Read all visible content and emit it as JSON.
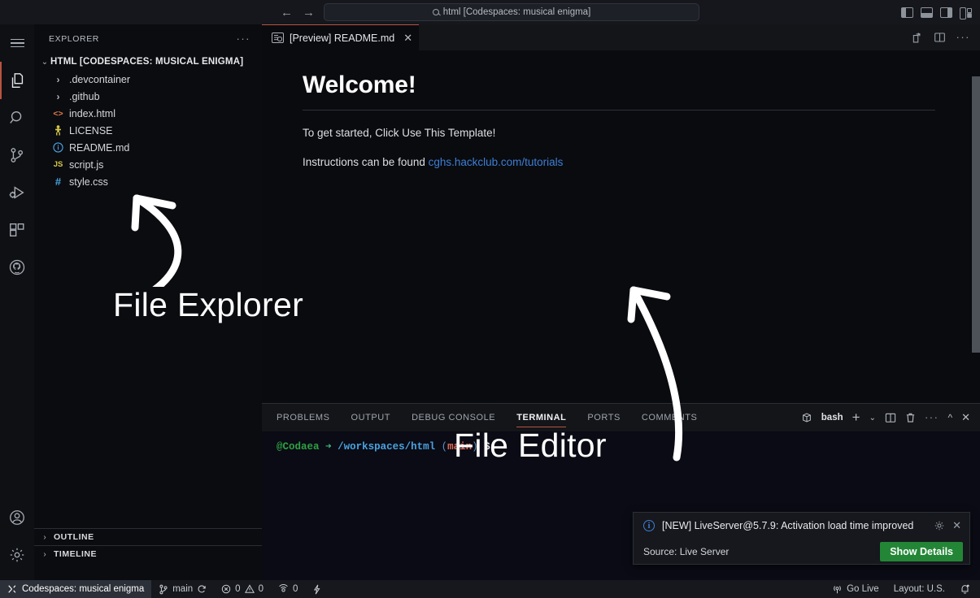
{
  "titlebar": {
    "back_icon": "arrow-left-icon",
    "forward_icon": "arrow-right-icon",
    "search_value": "html [Codespaces: musical enigma]",
    "search_placeholder": "Search",
    "layout_icons": [
      "toggle-primary-sidebar-icon",
      "toggle-panel-icon",
      "toggle-secondary-sidebar-icon",
      "customize-layout-icon"
    ]
  },
  "activitybar": {
    "items": [
      {
        "name": "menu-icon",
        "label": "Menu"
      },
      {
        "name": "explorer-icon",
        "label": "Explorer",
        "active": true
      },
      {
        "name": "search-icon",
        "label": "Search"
      },
      {
        "name": "source-control-icon",
        "label": "Source Control"
      },
      {
        "name": "run-and-debug-icon",
        "label": "Run and Debug"
      },
      {
        "name": "extensions-icon",
        "label": "Extensions"
      },
      {
        "name": "github-icon",
        "label": "GitHub"
      }
    ],
    "bottom_items": [
      {
        "name": "account-icon",
        "label": "Accounts"
      },
      {
        "name": "manage-gear-icon",
        "label": "Manage"
      }
    ]
  },
  "sidebar": {
    "title": "EXPLORER",
    "more_actions": "···",
    "root": {
      "label": "HTML [CODESPACES: MUSICAL ENIGMA]",
      "expanded": true
    },
    "files": [
      {
        "name": ".devcontainer",
        "type": "folder",
        "icon": "chevron-right-icon",
        "icon_char": "›",
        "color": "#b2b7bd"
      },
      {
        "name": ".github",
        "type": "folder",
        "icon": "chevron-right-icon",
        "icon_char": "›",
        "color": "#b2b7bd"
      },
      {
        "name": "index.html",
        "type": "file",
        "icon": "html-file-icon",
        "icon_char": "<>",
        "color": "#e07b4c"
      },
      {
        "name": "LICENSE",
        "type": "file",
        "icon": "license-file-icon",
        "icon_char": "⚕",
        "color": "#d7c84a"
      },
      {
        "name": "README.md",
        "type": "file",
        "icon": "markdown-info-icon",
        "icon_char": "ⓘ",
        "color": "#4aa3e0"
      },
      {
        "name": "script.js",
        "type": "file",
        "icon": "javascript-file-icon",
        "icon_char": "JS",
        "color": "#d7c84a"
      },
      {
        "name": "style.css",
        "type": "file",
        "icon": "css-file-icon",
        "icon_char": "#",
        "color": "#4aa3e0"
      }
    ],
    "sections": [
      {
        "label": "OUTLINE",
        "icon": "chevron-right-icon"
      },
      {
        "label": "TIMELINE",
        "icon": "chevron-right-icon"
      }
    ]
  },
  "editor": {
    "tab": {
      "label": "[Preview] README.md",
      "icon": "preview-icon",
      "close": "✕"
    },
    "actions": [
      {
        "name": "open-preview-to-side-icon"
      },
      {
        "name": "split-editor-icon"
      },
      {
        "name": "more-actions-icon",
        "char": "···"
      }
    ],
    "preview": {
      "heading": "Welcome!",
      "paragraph1": "To get started, Click Use This Template!",
      "paragraph2_prefix": "Instructions can be found ",
      "paragraph2_link": "cghs.hackclub.com/tutorials"
    }
  },
  "panel": {
    "tabs": [
      {
        "label": "PROBLEMS",
        "active": false
      },
      {
        "label": "OUTPUT",
        "active": false
      },
      {
        "label": "DEBUG CONSOLE",
        "active": false
      },
      {
        "label": "TERMINAL",
        "active": true
      },
      {
        "label": "PORTS",
        "active": false
      },
      {
        "label": "COMMENTS",
        "active": false
      }
    ],
    "shell_label": "bash",
    "actions": [
      {
        "name": "new-terminal-icon",
        "char": "+"
      },
      {
        "name": "chevron-down-icon",
        "char": "∨"
      },
      {
        "name": "split-terminal-icon"
      },
      {
        "name": "kill-terminal-icon"
      },
      {
        "name": "terminal-more-actions-icon",
        "char": "···"
      },
      {
        "name": "maximize-panel-icon",
        "char": "∧"
      },
      {
        "name": "close-panel-icon",
        "char": "✕"
      }
    ],
    "terminal_prompt": {
      "user": "@Codaea",
      "arrow": "➜",
      "path": "/workspaces/html",
      "paren_open": "(",
      "branch": "main",
      "paren_close": ")",
      "dollar": "$"
    }
  },
  "notification": {
    "icon": "info-icon",
    "message": "[NEW] LiveServer@5.7.9: Activation load time improved",
    "gear_icon": "gear-icon",
    "close_icon": "✕",
    "source": "Source: Live Server",
    "button": "Show Details",
    "button_color": "#238636"
  },
  "statusbar": {
    "remote": {
      "icon": "remote-indicator-icon",
      "label": "Codespaces: musical enigma"
    },
    "branch": {
      "icon": "source-control-icon",
      "label": "main",
      "sync_icon": "sync-icon"
    },
    "problems": {
      "error_icon": "error-icon",
      "errors": "0",
      "warning_icon": "warning-icon",
      "warnings": "0"
    },
    "ports": {
      "icon": "ports-icon",
      "count": "0"
    },
    "editor_actions": {
      "icon": "lightning-icon"
    },
    "right": [
      {
        "name": "go-live-button",
        "icon": "broadcast-icon",
        "label": "Go Live"
      },
      {
        "name": "keyboard-layout",
        "label": "Layout: U.S."
      },
      {
        "name": "notifications-bell-icon",
        "label": ""
      }
    ]
  },
  "annotations": [
    {
      "name": "file-explorer-annotation",
      "text": "File Explorer"
    },
    {
      "name": "file-editor-annotation",
      "text": "File Editor"
    }
  ]
}
